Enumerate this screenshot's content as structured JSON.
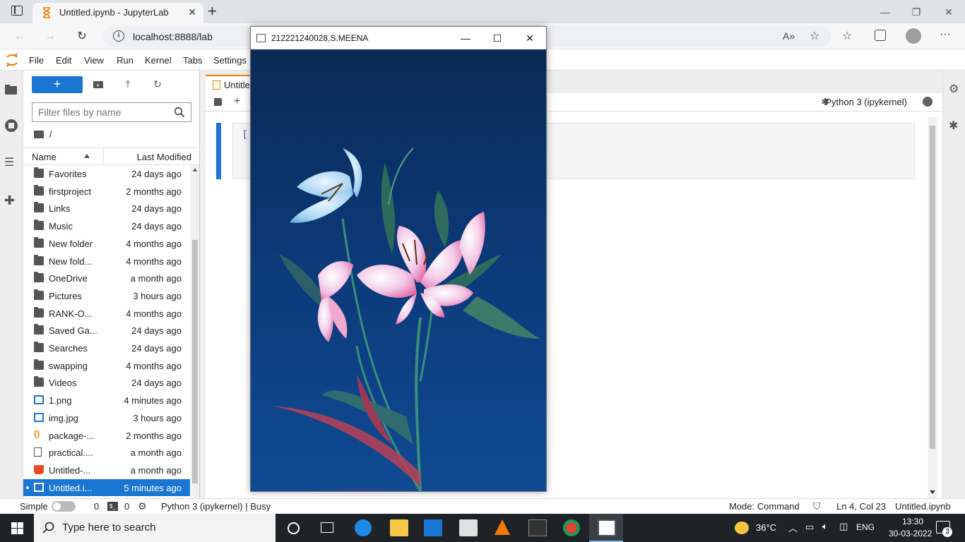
{
  "browser": {
    "tab_title": "Untitled.ipynb - JupyterLab",
    "url": "localhost:8888/lab"
  },
  "menubar": {
    "items": [
      "File",
      "Edit",
      "View",
      "Run",
      "Kernel",
      "Tabs",
      "Settings"
    ]
  },
  "filebrowser": {
    "new_label": "+",
    "filter_placeholder": "Filter files by name",
    "breadcrumb": "/",
    "col_name": "Name",
    "col_modified": "Last Modified",
    "files": [
      {
        "name": "Favorites",
        "modified": "24 days ago",
        "type": "folder"
      },
      {
        "name": "firstproject",
        "modified": "2 months ago",
        "type": "folder"
      },
      {
        "name": "Links",
        "modified": "24 days ago",
        "type": "folder"
      },
      {
        "name": "Music",
        "modified": "24 days ago",
        "type": "folder"
      },
      {
        "name": "New folder",
        "modified": "4 months ago",
        "type": "folder"
      },
      {
        "name": "New fold...",
        "modified": "4 months ago",
        "type": "folder"
      },
      {
        "name": "OneDrive",
        "modified": "a month ago",
        "type": "folder"
      },
      {
        "name": "Pictures",
        "modified": "3 hours ago",
        "type": "folder"
      },
      {
        "name": "RANK-O...",
        "modified": "4 months ago",
        "type": "folder"
      },
      {
        "name": "Saved Ga...",
        "modified": "24 days ago",
        "type": "folder"
      },
      {
        "name": "Searches",
        "modified": "24 days ago",
        "type": "folder"
      },
      {
        "name": "swapping",
        "modified": "4 months ago",
        "type": "folder"
      },
      {
        "name": "Videos",
        "modified": "24 days ago",
        "type": "folder"
      },
      {
        "name": "1.png",
        "modified": "4 minutes ago",
        "type": "image"
      },
      {
        "name": "img.jpg",
        "modified": "3 hours ago",
        "type": "image"
      },
      {
        "name": "package-...",
        "modified": "2 months ago",
        "type": "json"
      },
      {
        "name": "practical....",
        "modified": "a month ago",
        "type": "file"
      },
      {
        "name": "Untitled-...",
        "modified": "a month ago",
        "type": "html"
      },
      {
        "name": "Untitled.i...",
        "modified": "5 minutes ago",
        "type": "notebook",
        "selected": true
      }
    ]
  },
  "notebook": {
    "tab_label": "Untitle",
    "kernel_name": "Python 3 (ipykernel)",
    "cell_prompt": "["
  },
  "image_window": {
    "title": "212221240028,S.MEENA"
  },
  "statusbar": {
    "mode_label": "Simple",
    "terminals": "0",
    "kernels": "0",
    "kernel_status": "Python 3 (ipykernel) | Busy",
    "command_mode": "Mode: Command",
    "cursor": "Ln 4, Col 23",
    "filename": "Untitled.ipynb"
  },
  "taskbar": {
    "search_placeholder": "Type here to search",
    "temperature": "36°C",
    "language": "ENG",
    "time": "13:30",
    "date": "30-03-2022",
    "notifications": "3"
  },
  "colors": {
    "jupyter_blue": "#1976d2",
    "jupyter_orange": "#f57c00",
    "taskbar": "#1f2327"
  }
}
